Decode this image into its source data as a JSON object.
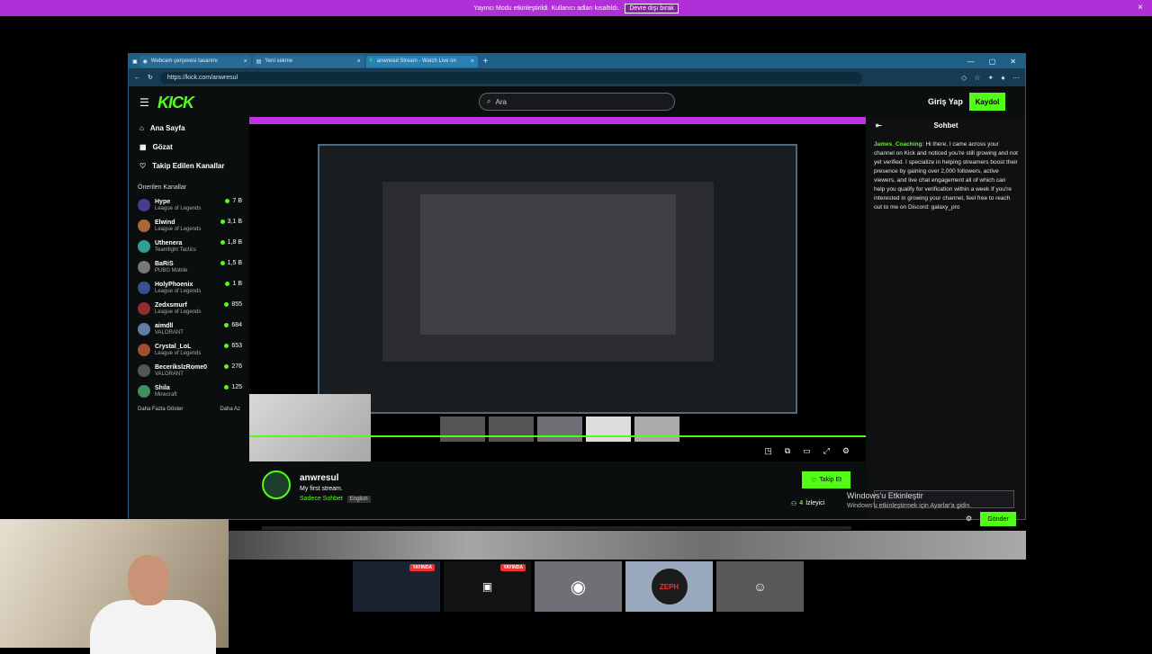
{
  "banner": {
    "text": "Yayıncı Modu etkinleştirildi. Kullanıcı adları kısaltıldı.",
    "button": "Devre dışı bırak",
    "close": "×"
  },
  "browser": {
    "tabs": [
      {
        "label": "Webcam çerçevesi tasarımı"
      },
      {
        "label": "Yeni sekme"
      },
      {
        "label": "anwresul Stream - Watch Live on"
      }
    ],
    "url": "https://kick.com/anwresul"
  },
  "kick": {
    "logo": "KICK",
    "search_placeholder": "Ara",
    "login": "Giriş Yap",
    "signup": "Kaydol"
  },
  "sidebar": {
    "nav": [
      {
        "label": "Ana Sayfa"
      },
      {
        "label": "Gözat"
      },
      {
        "label": "Takip Edilen Kanallar"
      }
    ],
    "section_title": "Önerilen Kanallar",
    "channels": [
      {
        "name": "Hype",
        "game": "League of Legends",
        "viewers": "7 B",
        "color": "#4a3b8f"
      },
      {
        "name": "Elwind",
        "game": "League of Legends",
        "viewers": "3,1 B",
        "color": "#a9673b"
      },
      {
        "name": "Uthenera",
        "game": "Teamfight Tactics",
        "viewers": "1,8 B",
        "color": "#2f9f8f"
      },
      {
        "name": "BaRiS",
        "game": "PUBG Mobile",
        "viewers": "1,5 B",
        "color": "#777777"
      },
      {
        "name": "HolyPhoenix",
        "game": "League of Legends",
        "viewers": "1 B",
        "color": "#3b4f8f"
      },
      {
        "name": "Zedxsmurf",
        "game": "League of Legends",
        "viewers": "855",
        "color": "#8f2f2f"
      },
      {
        "name": "aimdll",
        "game": "VALORANT",
        "viewers": "684",
        "color": "#5e7fa8"
      },
      {
        "name": "Crystal_LoL",
        "game": "League of Legends",
        "viewers": "653",
        "color": "#9f4f2f"
      },
      {
        "name": "BecerikslzRome0",
        "game": "VALORANT",
        "viewers": "276",
        "color": "#555555"
      },
      {
        "name": "Shila",
        "game": "Minecraft",
        "viewers": "125",
        "color": "#3f8f5f"
      }
    ],
    "show_more": "Daha Fazla Göster",
    "show_less": "Daha Az"
  },
  "chat": {
    "title": "Sohbet",
    "message_user": "James_Coaching:",
    "message_text": " Hi there, I came across your channel on Kick and noticed you're still growing and not yet verified. I specialize in helping streamers boost their presence by gaining over 2,000 followers, active viewers, and live chat engagement all of which can help you qualify for verification within a week If you're interested in growing your channel, feel free to reach out to me on Discord: galaxy_pro",
    "send": "Gönder"
  },
  "stream": {
    "name": "anwresul",
    "title": "My first stream.",
    "category": "Sadece Sohbet",
    "language": "English",
    "follow": "Takip Et",
    "viewers": "4",
    "viewers_label": "İzleyici"
  },
  "windows": {
    "activate_title": "Windows'u Etkinleştir",
    "activate_sub": "Windows'u etkinleştirmek için Ayarlar'a gidin."
  },
  "taskbar": {
    "live_label": "YAYINDA",
    "zeph_label": "ZEPH"
  }
}
